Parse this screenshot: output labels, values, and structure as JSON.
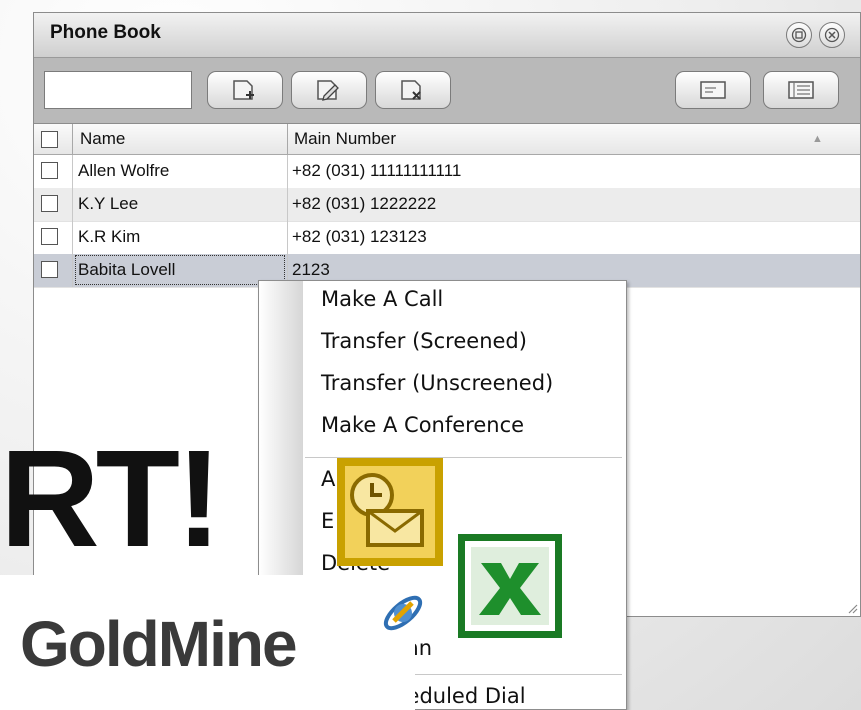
{
  "window": {
    "title": "Phone Book",
    "buttons": [
      "restore-icon",
      "close-icon"
    ]
  },
  "toolbar": {
    "search_value": "",
    "tools": [
      "add-contact-icon",
      "edit-contact-icon",
      "delete-contact-icon",
      "card-view-icon",
      "list-view-icon"
    ]
  },
  "table": {
    "columns": [
      "Name",
      "Main Number"
    ],
    "sort_indicator": "▲",
    "rows": [
      {
        "name": "Allen Wolfre",
        "number": "+82 (031) 11111111111"
      },
      {
        "name": "K.Y Lee",
        "number": "+82 (031) 1222222"
      },
      {
        "name": "K.R Kim",
        "number": "+82 (031) 123123"
      },
      {
        "name": "Babita Lovell",
        "number": "2123"
      }
    ],
    "selected_row": 3
  },
  "context_menu": {
    "items": [
      "Make A Call",
      "Transfer (Screened)",
      "Transfer (Unscreened)",
      "Make A Conference",
      "A",
      "E",
      "Delete",
      "ze Column",
      "Add Scheduled Dial"
    ]
  },
  "overlays": {
    "partial_logo_text": "RT!",
    "goldmine_logo": "GoldMine",
    "icons": [
      "outlook-icon",
      "excel-icon",
      "goldmine-icon"
    ]
  },
  "colors": {
    "window_frame": "#b9b9b9",
    "selected_row": "#c9cdd6",
    "goldmine_text": "#3a3a3a",
    "outlook_gold": "#c9a100",
    "excel_green": "#1a7a24"
  }
}
